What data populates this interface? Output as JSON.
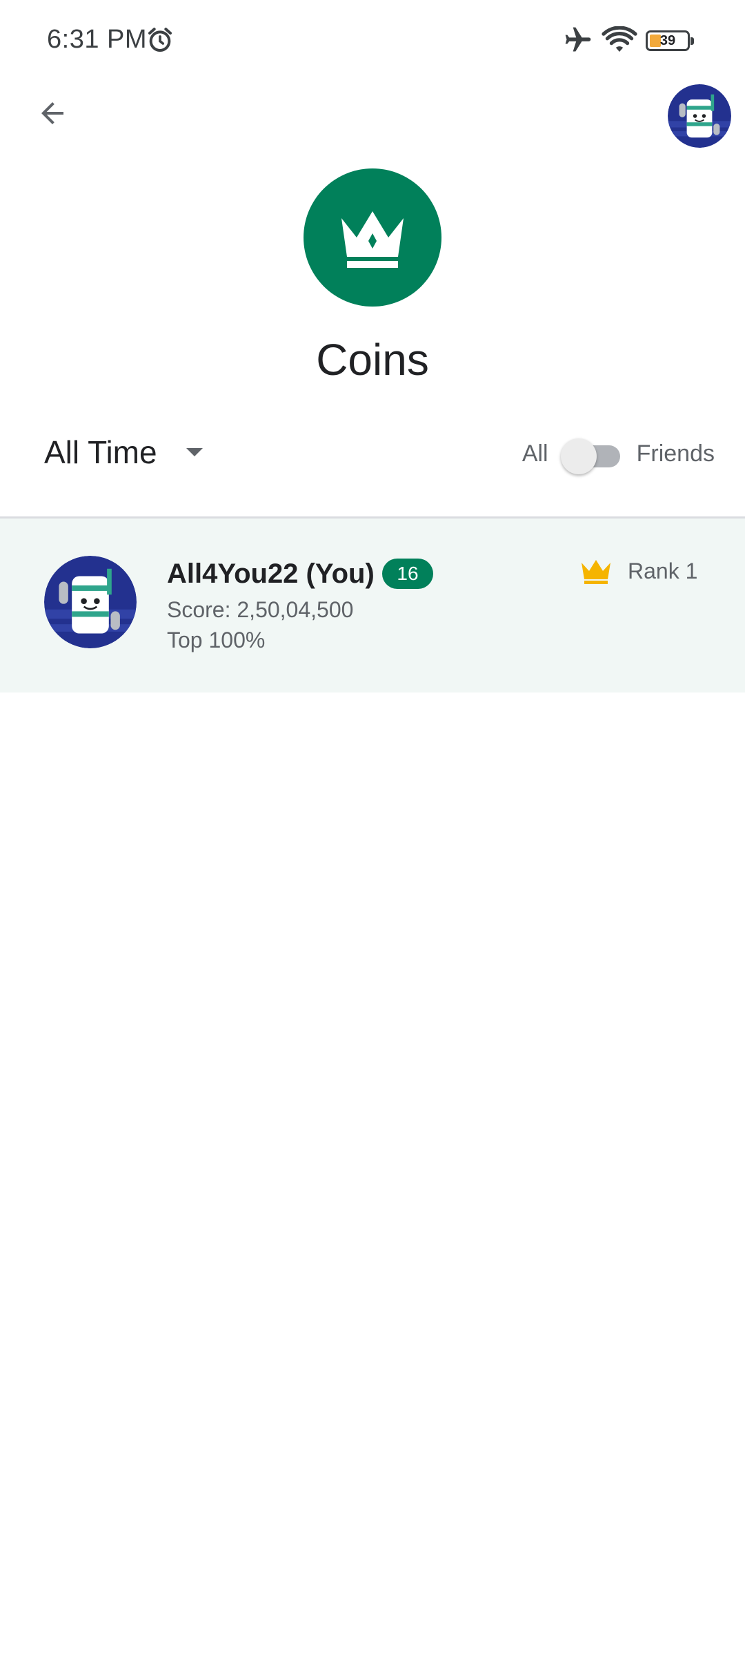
{
  "status_bar": {
    "time": "6:31 PM",
    "battery_level": "39",
    "icons": [
      "alarm-icon",
      "airplane-icon",
      "wifi-icon",
      "battery-icon"
    ]
  },
  "header": {
    "title": "Coins",
    "icon": "crown-icon",
    "icon_color": "#01805a"
  },
  "filters": {
    "time_span": "All Time",
    "scope_left": "All",
    "scope_right": "Friends",
    "scope_selected": "All"
  },
  "leaderboard": {
    "entries": [
      {
        "name": "All4You22 (You)",
        "level": "16",
        "score": "Score: 2,50,04,500",
        "top": "Top 100%",
        "rank": "Rank 1"
      }
    ]
  },
  "colors": {
    "accent": "#01805a",
    "row_highlight": "#f1f7f5",
    "crown_gold": "#f5b400"
  }
}
